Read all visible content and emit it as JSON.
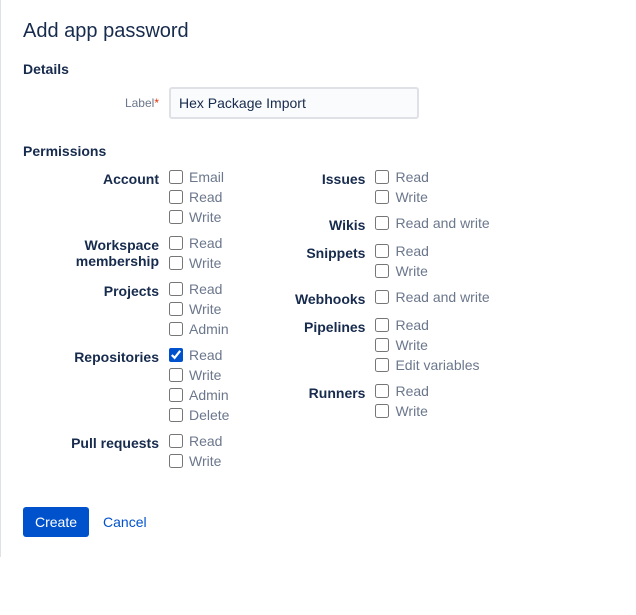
{
  "title": "Add app password",
  "details": {
    "heading": "Details",
    "label_field_label": "Label",
    "label_value": "Hex Package Import"
  },
  "permissions": {
    "heading": "Permissions",
    "left": [
      {
        "name": "Account",
        "opts": [
          {
            "label": "Email",
            "checked": false
          },
          {
            "label": "Read",
            "checked": false
          },
          {
            "label": "Write",
            "checked": false
          }
        ]
      },
      {
        "name": "Workspace membership",
        "opts": [
          {
            "label": "Read",
            "checked": false
          },
          {
            "label": "Write",
            "checked": false
          }
        ]
      },
      {
        "name": "Projects",
        "opts": [
          {
            "label": "Read",
            "checked": false
          },
          {
            "label": "Write",
            "checked": false
          },
          {
            "label": "Admin",
            "checked": false
          }
        ]
      },
      {
        "name": "Repositories",
        "opts": [
          {
            "label": "Read",
            "checked": true
          },
          {
            "label": "Write",
            "checked": false
          },
          {
            "label": "Admin",
            "checked": false
          },
          {
            "label": "Delete",
            "checked": false
          }
        ]
      },
      {
        "name": "Pull requests",
        "opts": [
          {
            "label": "Read",
            "checked": false
          },
          {
            "label": "Write",
            "checked": false
          }
        ]
      }
    ],
    "right": [
      {
        "name": "Issues",
        "opts": [
          {
            "label": "Read",
            "checked": false
          },
          {
            "label": "Write",
            "checked": false
          }
        ]
      },
      {
        "name": "Wikis",
        "opts": [
          {
            "label": "Read and write",
            "checked": false
          }
        ]
      },
      {
        "name": "Snippets",
        "opts": [
          {
            "label": "Read",
            "checked": false
          },
          {
            "label": "Write",
            "checked": false
          }
        ]
      },
      {
        "name": "Webhooks",
        "opts": [
          {
            "label": "Read and write",
            "checked": false
          }
        ]
      },
      {
        "name": "Pipelines",
        "opts": [
          {
            "label": "Read",
            "checked": false
          },
          {
            "label": "Write",
            "checked": false
          },
          {
            "label": "Edit variables",
            "checked": false
          }
        ]
      },
      {
        "name": "Runners",
        "opts": [
          {
            "label": "Read",
            "checked": false
          },
          {
            "label": "Write",
            "checked": false
          }
        ]
      }
    ]
  },
  "buttons": {
    "create": "Create",
    "cancel": "Cancel"
  }
}
